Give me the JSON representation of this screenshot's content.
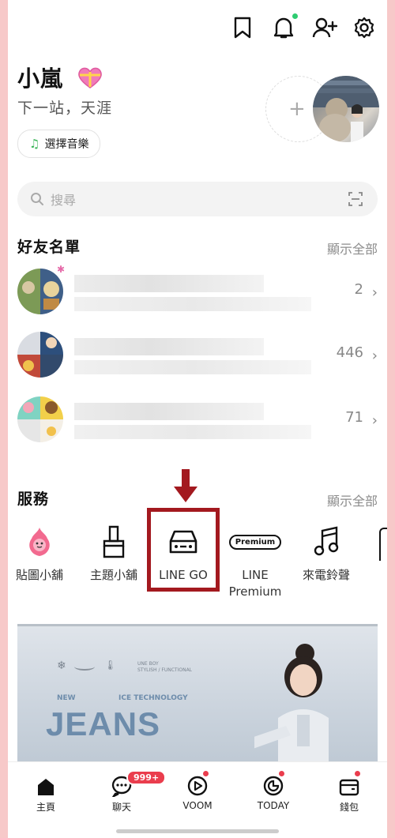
{
  "header": {
    "icons": [
      "bookmark-icon",
      "bell-icon",
      "add-friend-icon",
      "settings-icon"
    ],
    "notification_color": "#2ecc71"
  },
  "profile": {
    "name": "小嵐",
    "status": "下一站，天涯",
    "music_label": "選擇音樂",
    "add_label": "+"
  },
  "search": {
    "placeholder": "搜尋"
  },
  "friends": {
    "title": "好友名單",
    "show_all": "顯示全部",
    "rows": [
      {
        "count": "2"
      },
      {
        "count": "446"
      },
      {
        "count": "71"
      }
    ]
  },
  "services": {
    "title": "服務",
    "show_all": "顯示全部",
    "items": [
      {
        "label": "貼圖小舖"
      },
      {
        "label": "主題小舖"
      },
      {
        "label": "LINE GO"
      },
      {
        "label": "LINE Premium",
        "badge": "Premium"
      },
      {
        "label": "來電鈴聲"
      }
    ]
  },
  "banner": {
    "headline": "JEANS",
    "tag_new": "NEW",
    "tag_tech": "ICE TECHNOLOGY",
    "brand": "UNE BOY",
    "brand_sub": "STYLISH / FUNCTIONAL"
  },
  "tabbar": {
    "items": [
      {
        "label": "主頁"
      },
      {
        "label": "聊天",
        "badge": "999+"
      },
      {
        "label": "VOOM"
      },
      {
        "label": "TODAY"
      },
      {
        "label": "錢包"
      }
    ]
  },
  "colors": {
    "highlight": "#a3191f",
    "badge": "#ea3d4d",
    "page_border": "#f7c9c9"
  }
}
